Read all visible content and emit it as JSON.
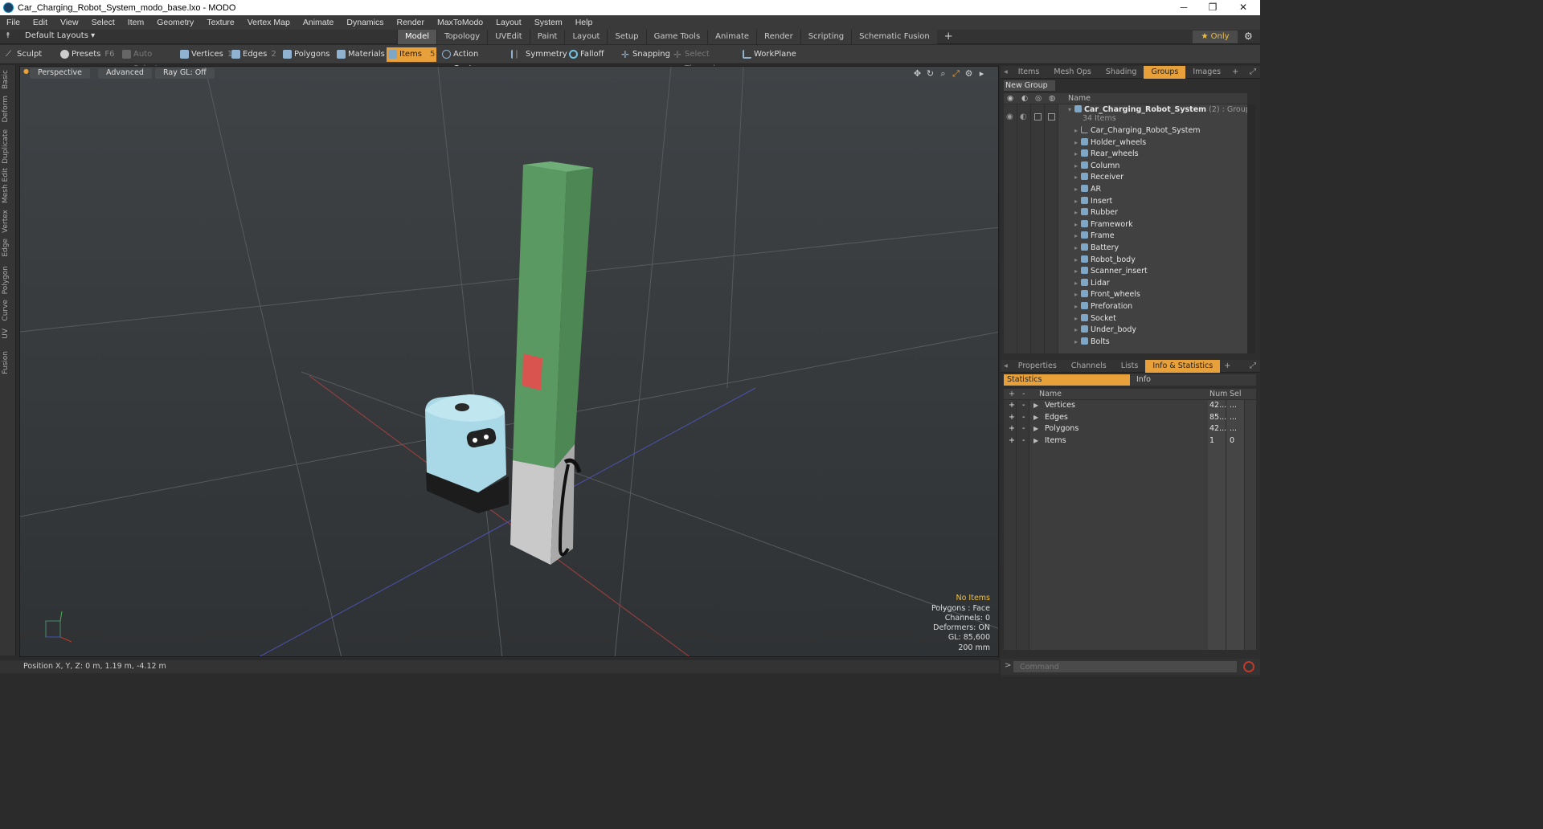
{
  "window": {
    "title": "Car_Charging_Robot_System_modo_base.lxo - MODO",
    "minimize": "─",
    "maximize": "❐",
    "close": "✕"
  },
  "menu": [
    "File",
    "Edit",
    "View",
    "Select",
    "Item",
    "Geometry",
    "Texture",
    "Vertex Map",
    "Animate",
    "Dynamics",
    "Render",
    "MaxToModo",
    "Layout",
    "System",
    "Help"
  ],
  "layout": {
    "name": "Default Layouts ▾",
    "tabs": [
      "Model",
      "Topology",
      "UVEdit",
      "Paint",
      "Layout",
      "Setup",
      "Game Tools",
      "Animate",
      "Render",
      "Scripting",
      "Schematic Fusion"
    ],
    "active_tab": "Model",
    "add": "+",
    "only": "★  Only"
  },
  "toolbar": {
    "sculpt": "Sculpt",
    "presets": "Presets",
    "presets_key": "F6",
    "auto_select": "Auto Select",
    "vertices": "Vertices",
    "vertices_key": "1",
    "edges": "Edges",
    "edges_key": "2",
    "polygons": "Polygons",
    "materials": "Materials",
    "items": "Items",
    "items_key": "5",
    "action_center": "Action Center",
    "symmetry": "Symmetry",
    "falloff": "Falloff",
    "snapping": "Snapping",
    "select_through": "Select Through",
    "workplane": "WorkPlane"
  },
  "left_tabs": [
    "Basic",
    "Deform",
    "Duplicate",
    "Mesh Edit",
    "Vertex",
    "Edge",
    "Polygon",
    "Curve",
    "UV",
    "Fusion"
  ],
  "viewport": {
    "view": "Perspective",
    "shading": "Advanced",
    "raygl": "Ray GL: Off",
    "info": {
      "selection": "No Items",
      "polygons": "Polygons : Face",
      "channels": "Channels: 0",
      "deformers": "Deformers: ON",
      "gl": "GL: 85,600",
      "scale": "200 mm"
    },
    "colors": {
      "column_green": "#5a9a62",
      "column_base": "#c9c9c9",
      "robot_blue": "#a9d8e6",
      "panel_red": "#d9534f"
    }
  },
  "status": {
    "position": "Position X, Y, Z:  0 m, 1.19 m, -4.12 m"
  },
  "groups_panel": {
    "tabs": [
      "Items",
      "Mesh Ops",
      "Shading",
      "Groups",
      "Images"
    ],
    "active_tab": "Groups",
    "add": "+",
    "new_group": "New Group",
    "header_name": "Name",
    "root": {
      "name": "Car_Charging_Robot_System",
      "count": "(2)",
      "type": ": Group",
      "sub": "34 Items"
    },
    "items": [
      "Car_Charging_Robot_System",
      "Holder_wheels",
      "Rear_wheels",
      "Column",
      "Receiver",
      "AR",
      "Insert",
      "Rubber",
      "Framework",
      "Frame",
      "Battery",
      "Robot_body",
      "Scanner_insert",
      "Lidar",
      "Front_wheels",
      "Preforation",
      "Socket",
      "Under_body",
      "Bolts"
    ]
  },
  "stats_panel": {
    "tabs": [
      "Properties",
      "Channels",
      "Lists",
      "Info & Statistics"
    ],
    "active_tab": "Info & Statistics",
    "add": "+",
    "subtabs": [
      "Statistics",
      "Info"
    ],
    "header": {
      "name": "Name",
      "num": "Num",
      "sel": "Sel"
    },
    "rows": [
      {
        "name": "Vertices",
        "num": "42...",
        "sel": "..."
      },
      {
        "name": "Edges",
        "num": "85...",
        "sel": "..."
      },
      {
        "name": "Polygons",
        "num": "42...",
        "sel": "..."
      },
      {
        "name": "Items",
        "num": "1",
        "sel": "0"
      }
    ]
  },
  "command": {
    "prompt": ">",
    "placeholder": "Command"
  }
}
